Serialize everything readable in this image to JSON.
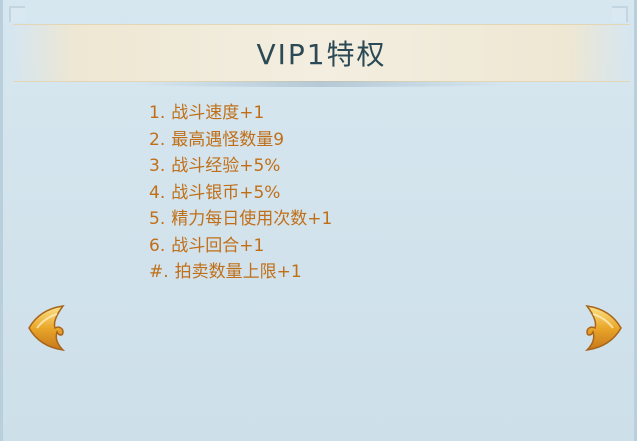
{
  "title": "VIP1特权",
  "perks": [
    {
      "num": "1.",
      "text": "战斗速度+1"
    },
    {
      "num": "2.",
      "text": "最高遇怪数量9"
    },
    {
      "num": "3.",
      "text": "战斗经验+5%"
    },
    {
      "num": "4.",
      "text": "战斗银币+5%"
    },
    {
      "num": "5.",
      "text": "精力每日使用次数+1"
    },
    {
      "num": "6.",
      "text": "战斗回合+1"
    },
    {
      "num": "#.",
      "text": "拍卖数量上限+1"
    }
  ],
  "nav": {
    "prev_icon": "left-arrow-icon",
    "next_icon": "right-arrow-icon"
  },
  "colors": {
    "title": "#2c4a55",
    "perk_text": "#c06f18",
    "background": "#cfe0ea",
    "arrow_gold": "#e8a628"
  }
}
